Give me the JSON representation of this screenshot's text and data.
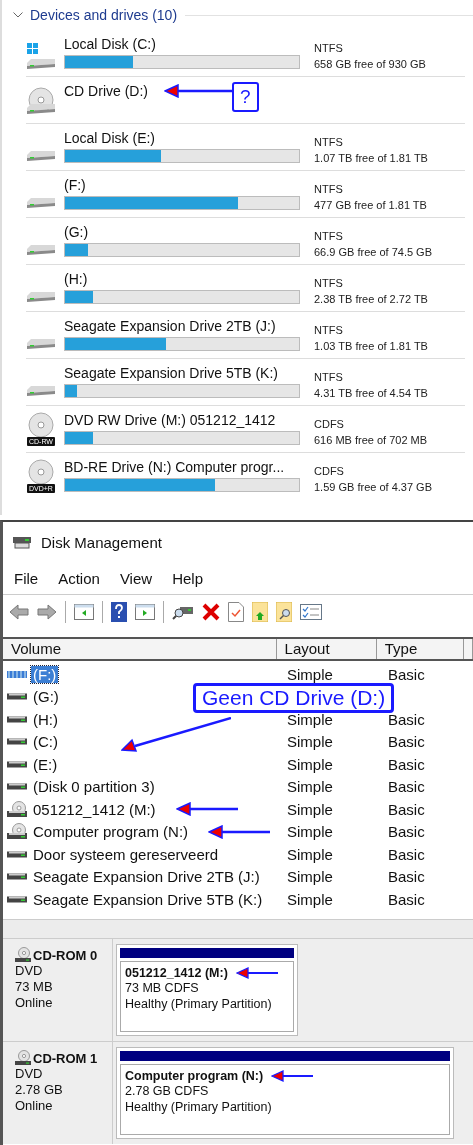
{
  "explorer": {
    "section": {
      "title": "Devices and drives (10)",
      "expanded": true
    },
    "drives": [
      {
        "kind": "system",
        "name": "Local Disk (C:)",
        "filesystem": "NTFS",
        "free": "658 GB free of 930 GB",
        "level": 0.29,
        "marked": false
      },
      {
        "kind": "cd",
        "name": "CD Drive (D:)",
        "marked": true,
        "note": "?"
      },
      {
        "kind": "hdd",
        "name": "Local Disk (E:)",
        "filesystem": "NTFS",
        "free": "1.07 TB free of 1.81 TB",
        "level": 0.41,
        "marked": false
      },
      {
        "kind": "hdd",
        "name": " (F:)",
        "filesystem": "NTFS",
        "free": "477 GB free of 1.81 TB",
        "level": 0.74,
        "marked": false
      },
      {
        "kind": "hdd",
        "name": " (G:)",
        "filesystem": "NTFS",
        "free": "66.9 GB free of 74.5 GB",
        "level": 0.1,
        "marked": false
      },
      {
        "kind": "hdd",
        "name": " (H:)",
        "filesystem": "NTFS",
        "free": "2.38 TB free of 2.72 TB",
        "level": 0.12,
        "marked": false
      },
      {
        "kind": "hdd",
        "name": "Seagate Expansion Drive 2TB (J:)",
        "filesystem": "NTFS",
        "free": "1.03 TB free of 1.81 TB",
        "level": 0.43,
        "marked": false
      },
      {
        "kind": "hdd",
        "name": "Seagate Expansion Drive 5TB (K:)",
        "filesystem": "NTFS",
        "free": "4.31 TB free of 4.54 TB",
        "level": 0.05,
        "marked": false
      },
      {
        "kind": "disc",
        "badge": "CD-RW",
        "name": "DVD RW Drive (M:) 051212_1412",
        "filesystem": "CDFS",
        "free": "616 MB free of 702 MB",
        "level": 0.12,
        "marked": false
      },
      {
        "kind": "disc",
        "badge": "DVD+R",
        "name": "BD-RE Drive (N:) Computer progr...",
        "filesystem": "CDFS",
        "free": "1.59 GB free of 4.37 GB",
        "level": 0.64,
        "marked": false
      }
    ]
  },
  "disk_management": {
    "window": {
      "title": "Disk Management"
    },
    "menu": [
      "File",
      "Action",
      "View",
      "Help"
    ],
    "table": {
      "columns": [
        "Volume",
        "Layout",
        "Type"
      ],
      "rows": [
        {
          "kind": "striped",
          "volume": "(F:)",
          "layout": "Simple",
          "type": "Basic",
          "selected": true,
          "marked": false
        },
        {
          "kind": "drive",
          "volume": " (G:)",
          "selected": false,
          "marked": false
        },
        {
          "kind": "drive",
          "volume": " (H:)",
          "layout": "Simple",
          "type": "Basic",
          "selected": false,
          "marked": false
        },
        {
          "kind": "drive",
          "volume": "(C:)",
          "layout": "Simple",
          "type": "Basic",
          "selected": false,
          "marked": false
        },
        {
          "kind": "drive",
          "volume": "(E:)",
          "layout": "Simple",
          "type": "Basic",
          "selected": false,
          "marked": false
        },
        {
          "kind": "drive",
          "volume": "(Disk 0 partition 3)",
          "layout": "Simple",
          "type": "Basic",
          "selected": false,
          "marked": false
        },
        {
          "kind": "disc",
          "volume": "051212_1412 (M:)",
          "layout": "Simple",
          "type": "Basic",
          "selected": false,
          "marked": true
        },
        {
          "kind": "disc",
          "volume": "Computer program (N:)",
          "layout": "Simple",
          "type": "Basic",
          "selected": false,
          "marked": true
        },
        {
          "kind": "drive",
          "volume": "Door systeem gereserveerd",
          "layout": "Simple",
          "type": "Basic",
          "selected": false,
          "marked": false
        },
        {
          "kind": "drive",
          "volume": "Seagate Expansion Drive 2TB (J:)",
          "layout": "Simple",
          "type": "Basic",
          "selected": false,
          "marked": false
        },
        {
          "kind": "drive",
          "volume": "Seagate Expansion Drive 5TB (K:)",
          "layout": "Simple",
          "type": "Basic",
          "selected": false,
          "marked": false
        }
      ],
      "annotation": "Geen CD Drive (D:)"
    },
    "disks": [
      {
        "name": "CD-ROM 0",
        "type": "DVD",
        "size": "73 MB",
        "status": "Online",
        "partition": {
          "title": "051212_1412  (M:)",
          "size": "73 MB CDFS",
          "health": "Healthy (Primary Partition)",
          "marked": true,
          "wide": false
        }
      },
      {
        "name": "CD-ROM 1",
        "type": "DVD",
        "size": "2.78 GB",
        "status": "Online",
        "partition": {
          "title": "Computer program  (N:)",
          "size": "2.78 GB CDFS",
          "health": "Healthy (Primary Partition)",
          "marked": true,
          "wide": true
        }
      }
    ]
  }
}
